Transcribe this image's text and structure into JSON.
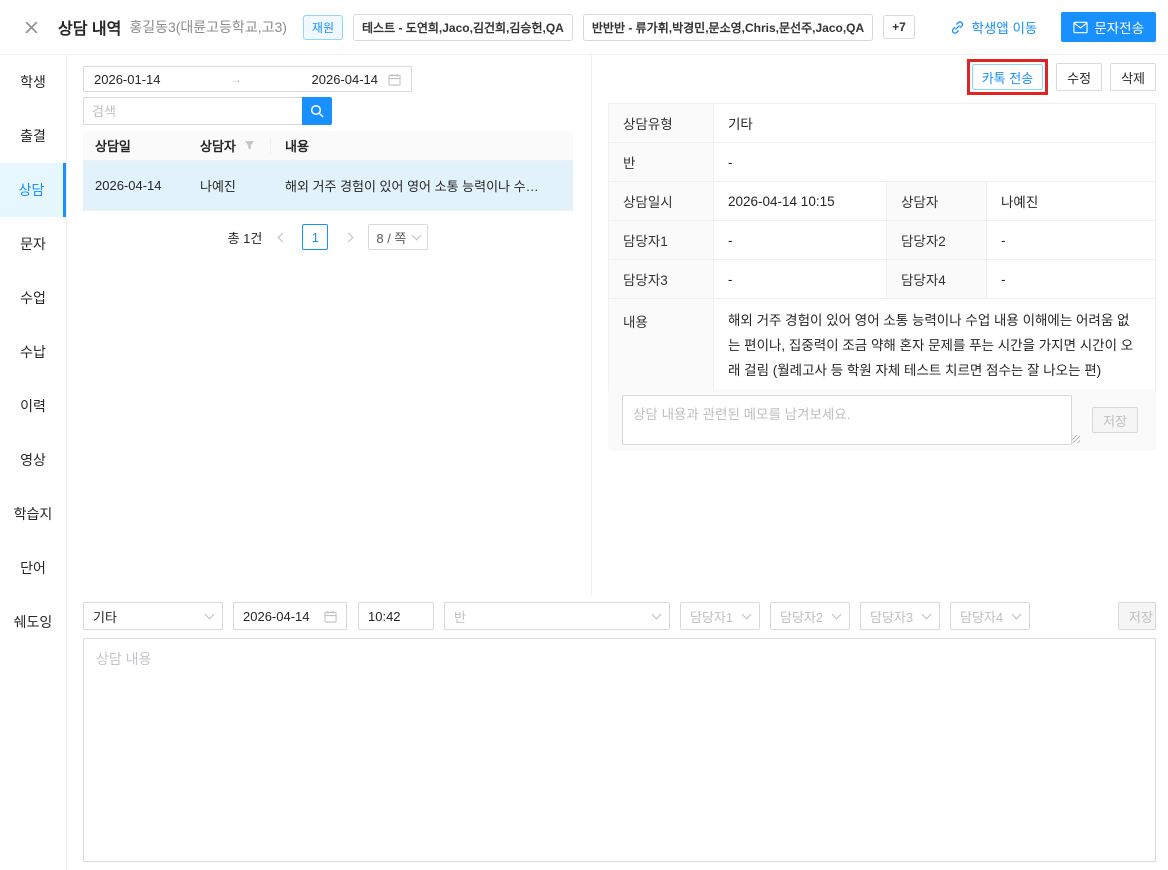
{
  "header": {
    "title": "상담 내역",
    "student": "홍길동3(대륜고등학교,고3)",
    "status_badge": "재원",
    "class_tags": [
      "테스트 - 도연희,Jaco,김건희,김승헌,QA",
      "반반반 - 류가휘,박경민,문소영,Chris,문선주,Jaco,QA"
    ],
    "more_badge": "+7",
    "student_app_link": "학생앱 이동",
    "sms_button": "문자전송"
  },
  "sidebar": {
    "items": [
      {
        "label": "학생"
      },
      {
        "label": "출결"
      },
      {
        "label": "상담",
        "active": true
      },
      {
        "label": "문자"
      },
      {
        "label": "수업"
      },
      {
        "label": "수납"
      },
      {
        "label": "이력"
      },
      {
        "label": "영상"
      },
      {
        "label": "학습지"
      },
      {
        "label": "단어"
      },
      {
        "label": "쉐도잉"
      }
    ]
  },
  "list_panel": {
    "date_from": "2026-01-14",
    "date_to": "2026-04-14",
    "search_placeholder": "검색",
    "columns": [
      "상담일",
      "상담자",
      "내용"
    ],
    "rows": [
      {
        "date": "2026-04-14",
        "counselor": "나예진",
        "content": "해외 거주 경험이 있어 영어 소통 능력이나 수…"
      }
    ],
    "pagination": {
      "total": "총 1건",
      "page": "1",
      "page_size": "8 / 쪽"
    }
  },
  "detail_panel": {
    "actions": {
      "kakao_send": "카톡 전송",
      "edit": "수정",
      "delete": "삭제"
    },
    "rows": {
      "type_label": "상담유형",
      "type_value": "기타",
      "class_label": "반",
      "class_value": "-",
      "datetime_label": "상담일시",
      "datetime_value": "2026-04-14 10:15",
      "counselor_label": "상담자",
      "counselor_value": "나예진",
      "manager1_label": "담당자1",
      "manager1_value": "-",
      "manager2_label": "담당자2",
      "manager2_value": "-",
      "manager3_label": "담당자3",
      "manager3_value": "-",
      "manager4_label": "담당자4",
      "manager4_value": "-",
      "content_label": "내용",
      "content_value": "해외 거주 경험이 있어 영어 소통 능력이나 수업 내용 이해에는 어려움 없는 편이나, 집중력이 조금 약해 혼자 문제를 푸는 시간을 가지면 시간이 오래 걸림 (월례고사 등 학원 자체 테스트 치르면 점수는 잘 나오는 편)"
    },
    "memo": {
      "placeholder": "상담 내용과 관련된 메모를 남겨보세요.",
      "save_label": "저장"
    }
  },
  "new_form": {
    "type_value": "기타",
    "date": "2026-04-14",
    "time": "10:42",
    "class_placeholder": "반",
    "managers": [
      "담당자1",
      "담당자2",
      "담당자3",
      "담당자4"
    ],
    "save_label": "저장",
    "content_placeholder": "상담 내용"
  },
  "colors": {
    "primary": "#1890ff",
    "selected_row": "#e1f2fb",
    "annotation_red": "#e02424",
    "status_badge_border": "#91d5ff"
  }
}
